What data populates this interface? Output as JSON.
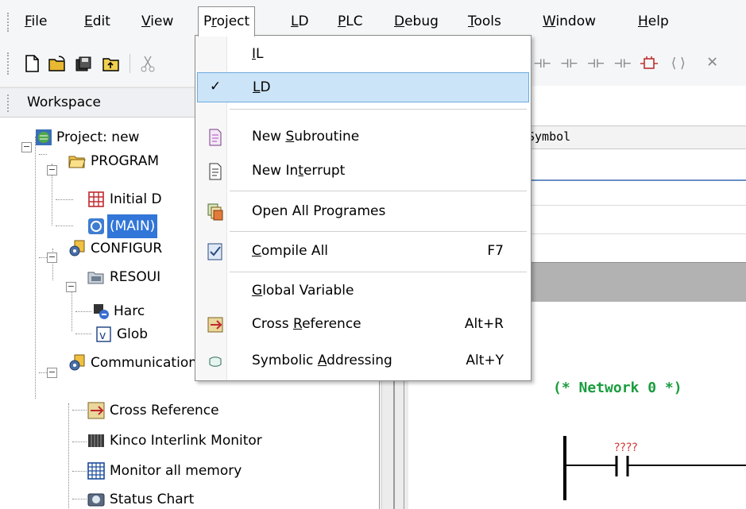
{
  "menubar": {
    "items": [
      {
        "label": "File",
        "u": "F",
        "rest": "ile",
        "pre": ""
      },
      {
        "label": "Edit",
        "u": "E",
        "rest": "dit",
        "pre": ""
      },
      {
        "label": "View",
        "u": "V",
        "rest": "iew",
        "pre": ""
      },
      {
        "label": "Project",
        "pre": "P",
        "u": "r",
        "rest": "oject"
      },
      {
        "label": "LD",
        "u": "L",
        "rest": "D",
        "pre": ""
      },
      {
        "label": "PLC",
        "u": "P",
        "rest": "LC",
        "pre": ""
      },
      {
        "label": "Debug",
        "u": "D",
        "rest": "ebug",
        "pre": ""
      },
      {
        "label": "Tools",
        "u": "T",
        "rest": "ools",
        "pre": ""
      },
      {
        "label": "Window",
        "u": "W",
        "rest": "indow",
        "pre": ""
      },
      {
        "label": "Help",
        "u": "H",
        "rest": "elp",
        "pre": ""
      }
    ]
  },
  "workspace": {
    "title": "Workspace",
    "tree": {
      "project": "Project: new",
      "programs": "PROGRAM",
      "initial": "Initial D",
      "main": "(MAIN)",
      "configuration": "CONFIGUR",
      "resource": "RESOUI",
      "hardware": "Harc",
      "global": "Glob",
      "comm": "Communication and Monitor",
      "cross_ref": "Cross Reference",
      "interlink": "Kinco Interlink Monitor",
      "monitor_mem": "Monitor all memory",
      "status_chart": "Status Chart"
    }
  },
  "editor": {
    "column_header": "Symbol",
    "network_label": "(* Network 0 *)",
    "contact_label": "????"
  },
  "project_menu": {
    "items": [
      {
        "pre": "",
        "u": "I",
        "rest": "L",
        "shortcut": "",
        "icon": "none-icon",
        "checked": false
      },
      {
        "pre": "",
        "u": "L",
        "rest": "D",
        "shortcut": "",
        "icon": "check-icon",
        "checked": true
      },
      {
        "pre": "New ",
        "u": "S",
        "rest": "ubroutine",
        "shortcut": "",
        "icon": "new-subroutine-icon",
        "checked": false
      },
      {
        "pre": "New In",
        "u": "t",
        "rest": "errupt",
        "shortcut": "",
        "icon": "new-interrupt-icon",
        "checked": false
      },
      {
        "pre": "Open All Programes",
        "u": "",
        "rest": "",
        "shortcut": "",
        "icon": "open-all-icon",
        "checked": false
      },
      {
        "pre": "",
        "u": "C",
        "rest": "ompile All",
        "shortcut": "F7",
        "icon": "compile-icon",
        "checked": false
      },
      {
        "pre": "",
        "u": "G",
        "rest": "lobal Variable",
        "shortcut": "",
        "icon": "none-icon",
        "checked": false
      },
      {
        "pre": "Cross ",
        "u": "R",
        "rest": "eference",
        "shortcut": "Alt+R",
        "icon": "cross-reference-icon",
        "checked": false
      },
      {
        "pre": "Symbolic ",
        "u": "A",
        "rest": "ddressing",
        "shortcut": "Alt+Y",
        "icon": "symbolic-addressing-icon",
        "checked": false
      }
    ]
  }
}
